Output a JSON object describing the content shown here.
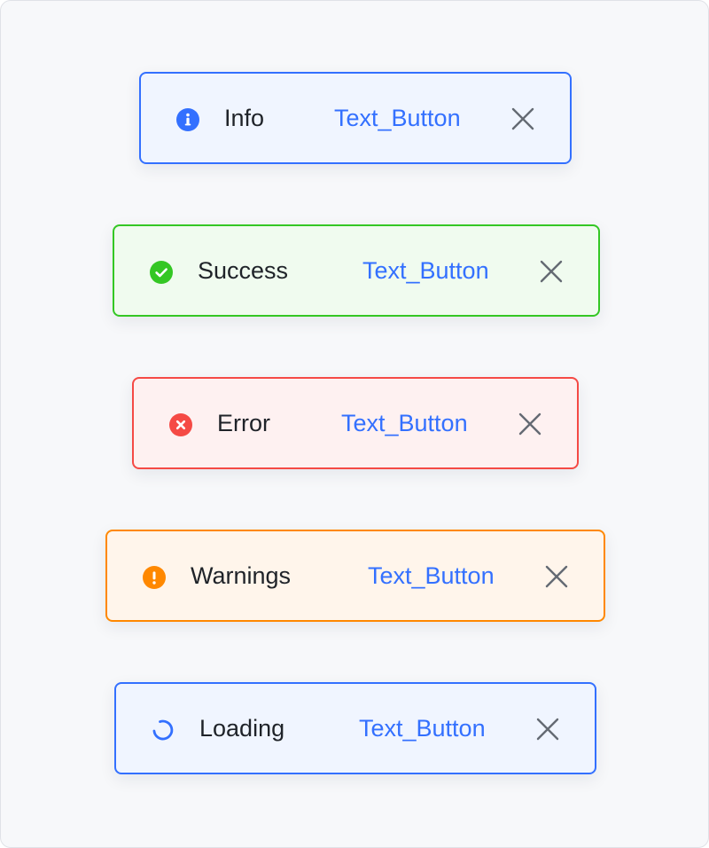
{
  "toasts": [
    {
      "type": "info",
      "title": "Info",
      "action_label": "Text_Button",
      "icon": "info-icon",
      "color": "#3370ff"
    },
    {
      "type": "success",
      "title": "Success",
      "action_label": "Text_Button",
      "icon": "success-icon",
      "color": "#34c724"
    },
    {
      "type": "error",
      "title": "Error",
      "action_label": "Text_Button",
      "icon": "error-icon",
      "color": "#f54a45"
    },
    {
      "type": "warning",
      "title": "Warnings",
      "action_label": "Text_Button",
      "icon": "warning-icon",
      "color": "#ff8800"
    },
    {
      "type": "loading",
      "title": "Loading",
      "action_label": "Text_Button",
      "icon": "loading-icon",
      "color": "#3370ff"
    }
  ],
  "colors": {
    "link": "#3370ff",
    "text": "#1f2329",
    "close_icon": "#646a73"
  }
}
